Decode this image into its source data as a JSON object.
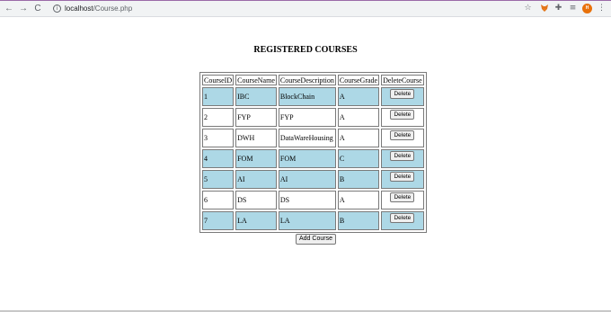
{
  "browser": {
    "back_glyph": "←",
    "forward_glyph": "→",
    "reload_glyph": "C",
    "info_glyph": "i",
    "url_host": "localhost",
    "url_path": "/Course.php",
    "star_glyph": "☆",
    "extension_glyph": "✚",
    "playlist_glyph": "≡",
    "avatar_initials": "H",
    "menu_glyph": "⋮",
    "icons": [
      "back-arrow-icon",
      "forward-arrow-icon",
      "reload-icon",
      "info-icon",
      "bookmark-star-icon",
      "metamask-fox-icon",
      "extensions-puzzle-icon",
      "media-playlist-icon",
      "profile-avatar",
      "kebab-menu-icon"
    ]
  },
  "page": {
    "title": "REGISTERED COURSES",
    "columns": [
      "CourseID",
      "CourseName",
      "CourseDescription",
      "CourseGrade",
      "DeleteCourse"
    ],
    "delete_label": "Delete",
    "rows": [
      {
        "id": "1",
        "name": "IBC",
        "description": "BlockChain",
        "grade": "A"
      },
      {
        "id": "2",
        "name": "FYP",
        "description": "FYP",
        "grade": "A"
      },
      {
        "id": "3",
        "name": "DWH",
        "description": "DataWareHousing",
        "grade": "A"
      },
      {
        "id": "4",
        "name": "FOM",
        "description": "FOM",
        "grade": "C"
      },
      {
        "id": "5",
        "name": "AI",
        "description": "AI",
        "grade": "B"
      },
      {
        "id": "6",
        "name": "DS",
        "description": "DS",
        "grade": "A"
      },
      {
        "id": "7",
        "name": "LA",
        "description": "LA",
        "grade": "B"
      }
    ],
    "add_course_label": "Add Course"
  },
  "colors": {
    "row_highlight": "#add8e6",
    "accent_top": "#9b6aa8",
    "avatar": "#e8710a"
  }
}
